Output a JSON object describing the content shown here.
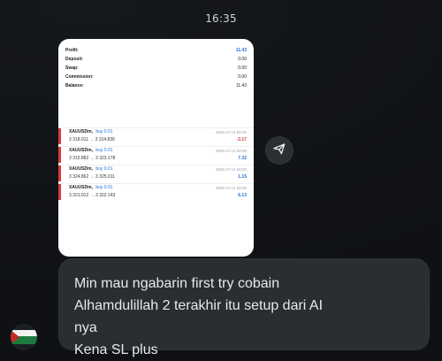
{
  "chat": {
    "time": "16:35",
    "image_message": {
      "summary": [
        {
          "label": "Profit:",
          "value": "11.43",
          "accent": true
        },
        {
          "label": "Deposit:",
          "value": "0.00"
        },
        {
          "label": "Swap:",
          "value": "0.00"
        },
        {
          "label": "Commission:",
          "value": "0.00"
        },
        {
          "label": "Balance:",
          "value": "11.43"
        }
      ],
      "trades": [
        {
          "symbol": "XAUUSDm,",
          "side": "buy 0.01",
          "prices": "3 318.011 → 3 314.836",
          "timestamp": "2025.07.14 00:00",
          "pl": "-3.17",
          "pl_color": "#d63b3b"
        },
        {
          "symbol": "XAUUSDm,",
          "side": "buy 0.01",
          "prices": "3 315.882 → 3 323.178",
          "timestamp": "2025.07.14 00:00",
          "pl": "7.32",
          "pl_color": "#1f6fd6"
        },
        {
          "symbol": "XAUUSDm,",
          "side": "buy 0.01",
          "prices": "3 324.862 → 3 325.011",
          "timestamp": "2025.07.14 00:00",
          "pl": "1.15",
          "pl_color": "#1f6fd6"
        },
        {
          "symbol": "XAUUSDm,",
          "side": "buy 0.01",
          "prices": "3 321.012 → 3 322.143",
          "timestamp": "2025.07.14 00:00",
          "pl": "6.13",
          "pl_color": "#1f6fd6"
        }
      ]
    },
    "text_message": {
      "lines": [
        "Min mau ngabarin first try cobain",
        "Alhamdulillah 2 terakhir itu setup dari AI",
        "nya",
        "Kena SL plus"
      ]
    },
    "icons": {
      "forward": "forward-icon",
      "avatar": "avatar"
    }
  }
}
